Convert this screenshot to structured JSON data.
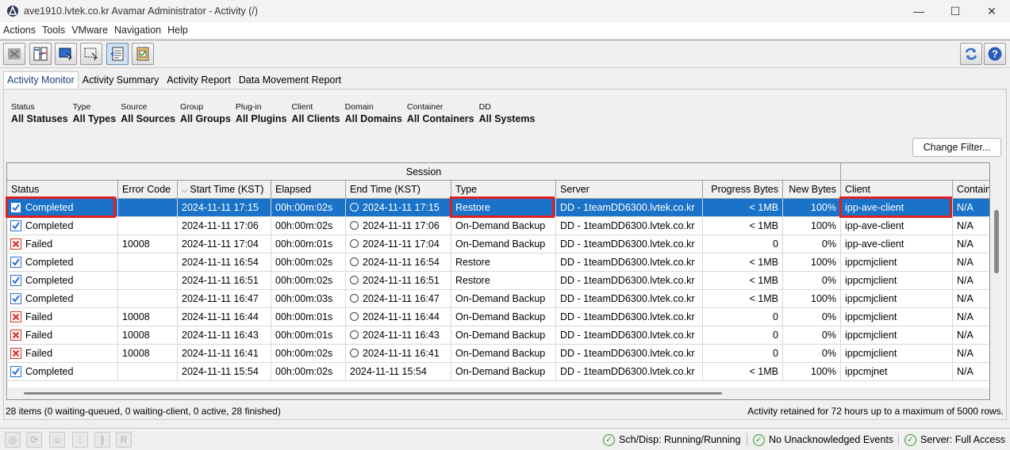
{
  "window": {
    "title": "ave1910.lvtek.co.kr Avamar Administrator - Activity (/)",
    "controls": [
      "—",
      "☐",
      "✕"
    ]
  },
  "menu": [
    "Actions",
    "Tools",
    "VMware",
    "Navigation",
    "Help"
  ],
  "toolbar": {
    "left_icons": [
      "cancel-activity-icon",
      "split-view-icon",
      "select-client-icon",
      "select-area-icon",
      "activity-list-icon",
      "report-icon"
    ],
    "right_icons": [
      "refresh-icon",
      "help-icon"
    ]
  },
  "tabs": [
    "Activity Monitor",
    "Activity Summary",
    "Activity Report",
    "Data Movement Report"
  ],
  "filters": [
    {
      "label": "Status",
      "value": "All Statuses"
    },
    {
      "label": "Type",
      "value": "All Types"
    },
    {
      "label": "Source",
      "value": "All Sources"
    },
    {
      "label": "Group",
      "value": "All Groups"
    },
    {
      "label": "Plug-in",
      "value": "All Plugins"
    },
    {
      "label": "Client",
      "value": "All Clients"
    },
    {
      "label": "Domain",
      "value": "All Domains"
    },
    {
      "label": "Container",
      "value": "All Containers"
    },
    {
      "label": "DD",
      "value": "All Systems"
    }
  ],
  "change_filter_label": "Change Filter...",
  "table": {
    "group_header": "Session",
    "columns": [
      "Status",
      "Error Code",
      "Start Time (KST)",
      "Elapsed",
      "End Time (KST)",
      "Type",
      "Server",
      "Progress Bytes",
      "New Bytes",
      "Client",
      "Contain"
    ],
    "rows": [
      {
        "status": "Completed",
        "ok": true,
        "error": "",
        "start": "2024-11-11 17:15",
        "elapsed": "00h:00m:02s",
        "end": "2024-11-11 17:15",
        "clock": true,
        "type": "Restore",
        "server": "DD - 1teamDD6300.lvtek.co.kr",
        "progress": "< 1MB",
        "new": "100%",
        "client": "ipp-ave-client",
        "container": "N/A"
      },
      {
        "status": "Completed",
        "ok": true,
        "error": "",
        "start": "2024-11-11 17:06",
        "elapsed": "00h:00m:02s",
        "end": "2024-11-11 17:06",
        "clock": true,
        "type": "On-Demand Backup",
        "server": "DD - 1teamDD6300.lvtek.co.kr",
        "progress": "< 1MB",
        "new": "100%",
        "client": "ipp-ave-client",
        "container": "N/A"
      },
      {
        "status": "Failed",
        "ok": false,
        "error": "10008",
        "start": "2024-11-11 17:04",
        "elapsed": "00h:00m:01s",
        "end": "2024-11-11 17:04",
        "clock": true,
        "type": "On-Demand Backup",
        "server": "DD - 1teamDD6300.lvtek.co.kr",
        "progress": "0",
        "new": "0%",
        "client": "ipp-ave-client",
        "container": "N/A"
      },
      {
        "status": "Completed",
        "ok": true,
        "error": "",
        "start": "2024-11-11 16:54",
        "elapsed": "00h:00m:02s",
        "end": "2024-11-11 16:54",
        "clock": true,
        "type": "Restore",
        "server": "DD - 1teamDD6300.lvtek.co.kr",
        "progress": "< 1MB",
        "new": "100%",
        "client": "ippcmjclient",
        "container": "N/A"
      },
      {
        "status": "Completed",
        "ok": true,
        "error": "",
        "start": "2024-11-11 16:51",
        "elapsed": "00h:00m:02s",
        "end": "2024-11-11 16:51",
        "clock": true,
        "type": "Restore",
        "server": "DD - 1teamDD6300.lvtek.co.kr",
        "progress": "< 1MB",
        "new": "0%",
        "client": "ippcmjclient",
        "container": "N/A"
      },
      {
        "status": "Completed",
        "ok": true,
        "error": "",
        "start": "2024-11-11 16:47",
        "elapsed": "00h:00m:03s",
        "end": "2024-11-11 16:47",
        "clock": true,
        "type": "On-Demand Backup",
        "server": "DD - 1teamDD6300.lvtek.co.kr",
        "progress": "< 1MB",
        "new": "100%",
        "client": "ippcmjclient",
        "container": "N/A"
      },
      {
        "status": "Failed",
        "ok": false,
        "error": "10008",
        "start": "2024-11-11 16:44",
        "elapsed": "00h:00m:01s",
        "end": "2024-11-11 16:44",
        "clock": true,
        "type": "On-Demand Backup",
        "server": "DD - 1teamDD6300.lvtek.co.kr",
        "progress": "0",
        "new": "0%",
        "client": "ippcmjclient",
        "container": "N/A"
      },
      {
        "status": "Failed",
        "ok": false,
        "error": "10008",
        "start": "2024-11-11 16:43",
        "elapsed": "00h:00m:01s",
        "end": "2024-11-11 16:43",
        "clock": true,
        "type": "On-Demand Backup",
        "server": "DD - 1teamDD6300.lvtek.co.kr",
        "progress": "0",
        "new": "0%",
        "client": "ippcmjclient",
        "container": "N/A"
      },
      {
        "status": "Failed",
        "ok": false,
        "error": "10008",
        "start": "2024-11-11 16:41",
        "elapsed": "00h:00m:02s",
        "end": "2024-11-11 16:41",
        "clock": true,
        "type": "On-Demand Backup",
        "server": "DD - 1teamDD6300.lvtek.co.kr",
        "progress": "0",
        "new": "0%",
        "client": "ippcmjclient",
        "container": "N/A"
      },
      {
        "status": "Completed",
        "ok": true,
        "error": "",
        "start": "2024-11-11 15:54",
        "elapsed": "00h:00m:02s",
        "end": "2024-11-11 15:54",
        "clock": false,
        "type": "On-Demand Backup",
        "server": "DD - 1teamDD6300.lvtek.co.kr",
        "progress": "< 1MB",
        "new": "100%",
        "client": "ippcmjnet",
        "container": "N/A"
      }
    ]
  },
  "status_left": "28 items (0 waiting-queued, 0 waiting-client, 0 active, 28 finished)",
  "status_right": "Activity retained for 72 hours up to a maximum of 5000 rows.",
  "footer": {
    "icons": [
      "disabled-circle-icon",
      "disabled-refresh-icon",
      "disabled-user-icon",
      "disabled-dots-icon",
      "disabled-books-icon",
      "disabled-r-icon"
    ],
    "sch_disp": "Sch/Disp: Running/Running",
    "events": "No Unacknowledged Events",
    "server": "Server: Full Access"
  },
  "colors": {
    "selected_row": "#1a73c8",
    "highlight": "#e02020",
    "ok_green": "#2a9a2a",
    "failed_red": "#d93025"
  }
}
